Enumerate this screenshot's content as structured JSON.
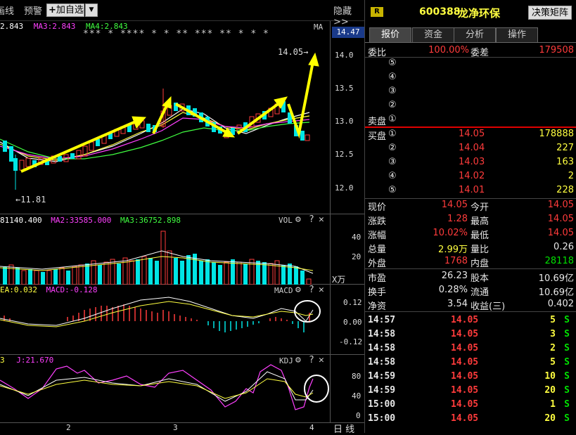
{
  "toolbar": {
    "btn_line": "画线",
    "btn_alert": "预警",
    "btn_add": "加自选",
    "btn_hide": "隐藏>>"
  },
  "main_chart": {
    "ma_labels": [
      {
        "text": "2.843",
        "color": "#ffffff"
      },
      {
        "text": "MA3:2.843",
        "color": "#ff40ff"
      },
      {
        "text": "MA4:2.843",
        "color": "#40ff40"
      }
    ],
    "ma_tag": "MA",
    "stars": "*** * **** * * ** *** ** * * *",
    "price_axis": [
      "14.0",
      "13.5",
      "13.0",
      "12.5",
      "12.0"
    ],
    "price_current": "14.47",
    "high_note": "14.05",
    "low_note": "11.81"
  },
  "vol_panel": {
    "labels": [
      {
        "text": "81140.400",
        "color": "#ffffff"
      },
      {
        "text": "MA2:33585.000",
        "color": "#ff40ff"
      },
      {
        "text": "MA3:36752.898",
        "color": "#40ff40"
      }
    ],
    "title": "VOL",
    "axis": [
      "40",
      "20"
    ],
    "unit": "X万"
  },
  "macd_panel": {
    "labels": [
      {
        "text": "EA:0.032",
        "color": "#ffff40"
      },
      {
        "text": "MACD:-0.128",
        "color": "#ff40ff"
      }
    ],
    "title": "MACD",
    "axis": [
      "0.12",
      "0.00",
      "-0.12"
    ]
  },
  "kdj_panel": {
    "labels": [
      {
        "text": "3",
        "color": "#ffff40"
      },
      {
        "text": "J:21.670",
        "color": "#ff40ff"
      }
    ],
    "title": "KDJ",
    "axis": [
      "80",
      "40",
      "0"
    ]
  },
  "x_axis": {
    "ticks": [
      "2",
      "3",
      "4"
    ],
    "period": "日 线"
  },
  "right": {
    "badge": "R",
    "code": "600388",
    "name": "龙净环保",
    "decision_btn": "决策矩阵",
    "tabs": [
      "报价",
      "资金",
      "分析",
      "操作"
    ],
    "weibi_label": "委比",
    "weibi_value": "100.00%",
    "weicha_label": "委差",
    "weicha_value": "179508",
    "sell_levels": [
      "⑤",
      "④",
      "③",
      "②",
      "①"
    ],
    "sell_label": "卖盘",
    "buy_label": "买盘",
    "buy_rows": [
      {
        "idx": "①",
        "price": "14.05",
        "vol": "178888"
      },
      {
        "idx": "②",
        "price": "14.04",
        "vol": "227"
      },
      {
        "idx": "③",
        "price": "14.03",
        "vol": "163"
      },
      {
        "idx": "④",
        "price": "14.02",
        "vol": "2"
      },
      {
        "idx": "⑤",
        "price": "14.01",
        "vol": "228"
      }
    ],
    "stats": [
      {
        "l1": "现价",
        "v1": "14.05",
        "c1": "red",
        "l2": "今开",
        "v2": "14.05",
        "c2": "red"
      },
      {
        "l1": "涨跌",
        "v1": "1.28",
        "c1": "red",
        "l2": "最高",
        "v2": "14.05",
        "c2": "red"
      },
      {
        "l1": "涨幅",
        "v1": "10.02%",
        "c1": "red",
        "l2": "最低",
        "v2": "14.05",
        "c2": "red"
      },
      {
        "l1": "总量",
        "v1": "2.99万",
        "c1": "yel",
        "l2": "量比",
        "v2": "0.26",
        "c2": "wht"
      },
      {
        "l1": "外盘",
        "v1": "1768",
        "c1": "red",
        "l2": "内盘",
        "v2": "28118",
        "c2": "grn"
      }
    ],
    "fund": [
      {
        "l1": "市盈",
        "v1": "26.23",
        "l2": "股本",
        "v2": "10.69亿"
      },
      {
        "l1": "换手",
        "v1": "0.28%",
        "l2": "流通",
        "v2": "10.69亿"
      },
      {
        "l1": "净资",
        "v1": "3.54",
        "l2": "收益(三)",
        "v2": "0.402"
      }
    ],
    "ticks": [
      {
        "time": "14:57",
        "price": "14.05",
        "vol": "5",
        "side": "S"
      },
      {
        "time": "14:58",
        "price": "14.05",
        "vol": "3",
        "side": "S"
      },
      {
        "time": "14:58",
        "price": "14.05",
        "vol": "2",
        "side": "S"
      },
      {
        "time": "14:58",
        "price": "14.05",
        "vol": "5",
        "side": "S"
      },
      {
        "time": "14:59",
        "price": "14.05",
        "vol": "10",
        "side": "S"
      },
      {
        "time": "14:59",
        "price": "14.05",
        "vol": "20",
        "side": "S"
      },
      {
        "time": "15:00",
        "price": "14.05",
        "vol": "1",
        "side": "S"
      },
      {
        "time": "15:00",
        "price": "14.05",
        "vol": "20",
        "side": "S"
      }
    ]
  }
}
